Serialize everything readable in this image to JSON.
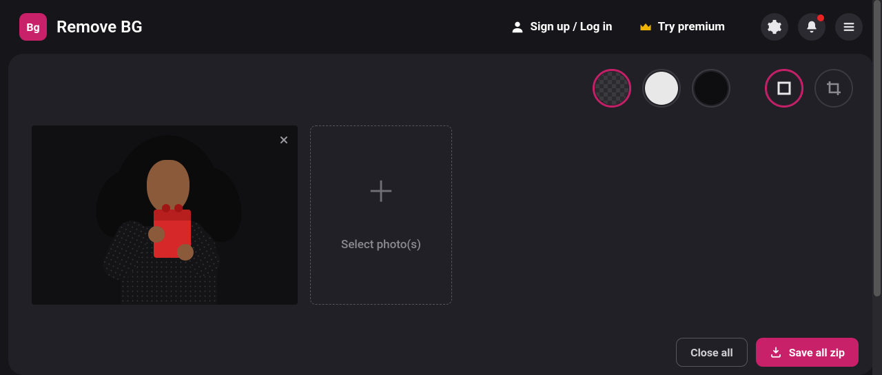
{
  "header": {
    "logo_text": "Bg",
    "app_title": "Remove BG",
    "signup_login": "Sign up / Log in",
    "try_premium": "Try premium"
  },
  "bg_options": {
    "transparent_selected": true,
    "white_selected": false,
    "black_selected": false,
    "square_mode_selected": true,
    "crop_mode_selected": false
  },
  "dropzone": {
    "label": "Select photo(s)"
  },
  "footer": {
    "close_all": "Close all",
    "save_all_zip": "Save all zip"
  },
  "colors": {
    "accent": "#c9206a"
  }
}
